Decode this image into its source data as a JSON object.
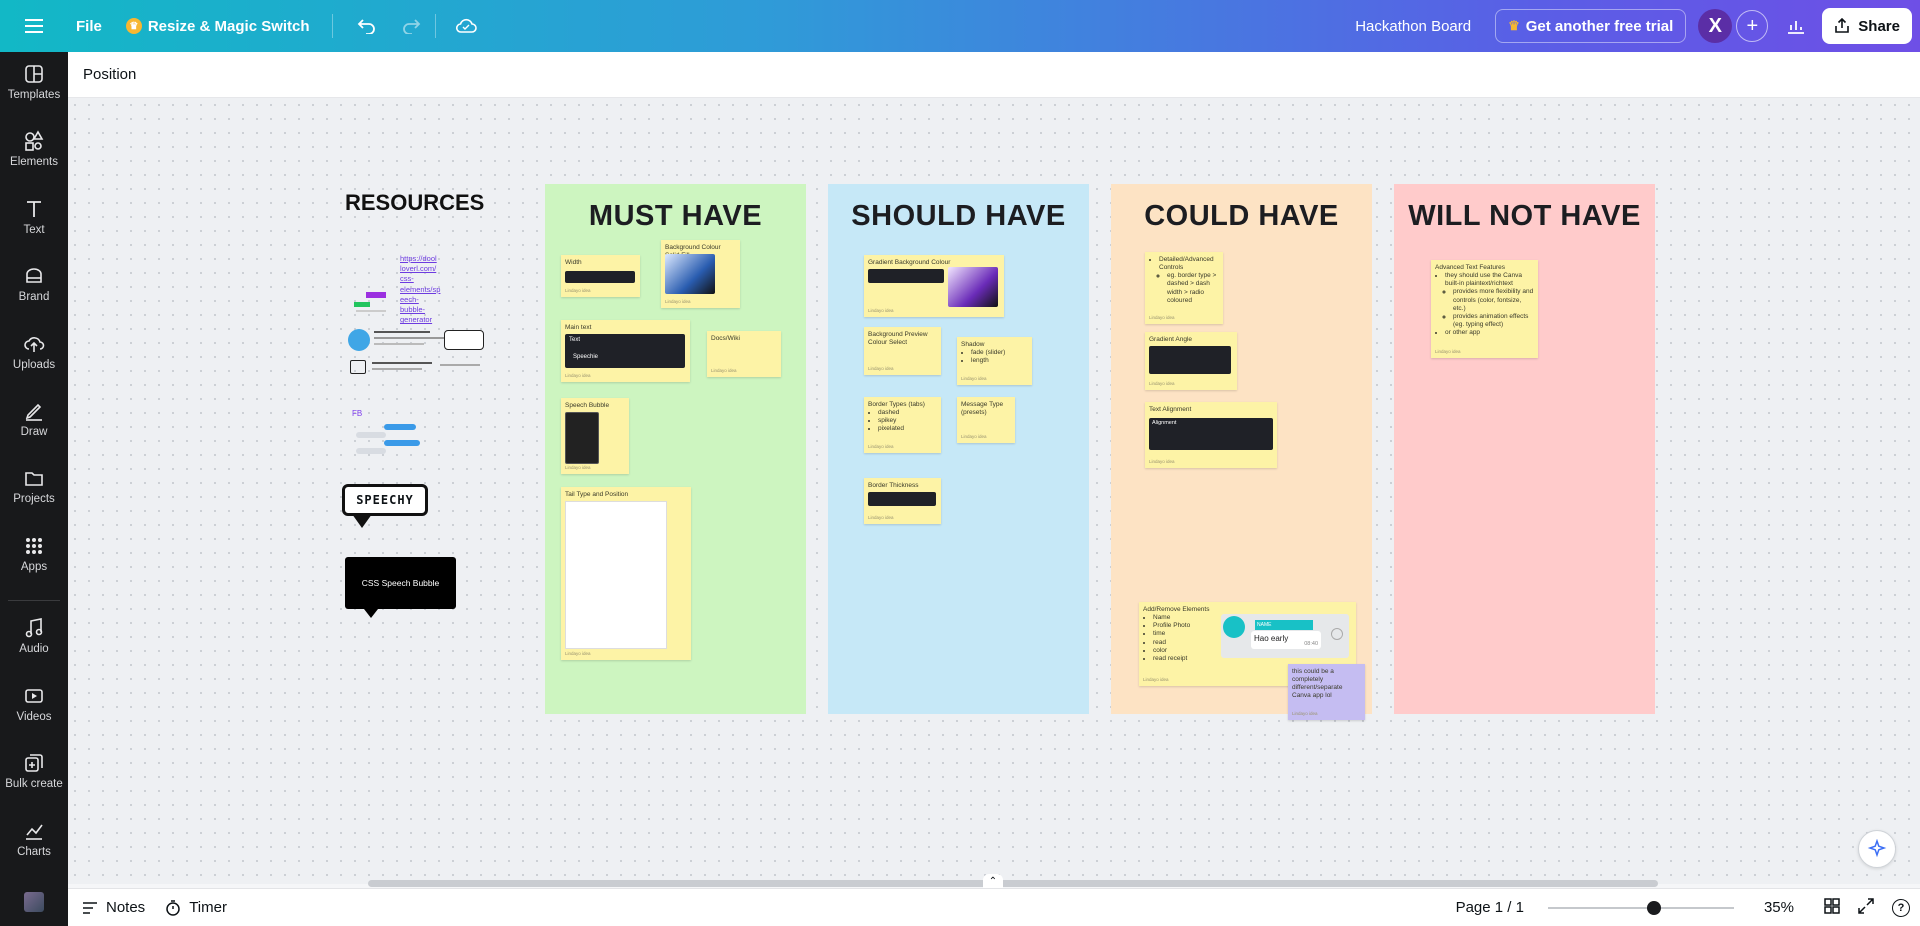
{
  "topbar": {
    "file_label": "File",
    "resize_label": "Resize & Magic Switch",
    "board_title": "Hackathon Board",
    "trial_label": "Get another free trial",
    "avatar_letter": "X",
    "share_label": "Share",
    "crown_icon": "crown-icon"
  },
  "position_label": "Position",
  "sidebar": {
    "items": [
      {
        "label": "Templates",
        "icon": "templates-icon"
      },
      {
        "label": "Elements",
        "icon": "elements-icon"
      },
      {
        "label": "Text",
        "icon": "text-icon"
      },
      {
        "label": "Brand",
        "icon": "brand-icon"
      },
      {
        "label": "Uploads",
        "icon": "uploads-icon"
      },
      {
        "label": "Draw",
        "icon": "draw-icon"
      },
      {
        "label": "Projects",
        "icon": "projects-icon"
      },
      {
        "label": "Apps",
        "icon": "apps-icon"
      },
      {
        "label": "Audio",
        "icon": "audio-icon"
      },
      {
        "label": "Videos",
        "icon": "videos-icon"
      },
      {
        "label": "Bulk create",
        "icon": "bulk-create-icon"
      },
      {
        "label": "Charts",
        "icon": "charts-icon"
      }
    ]
  },
  "bottombar": {
    "notes_label": "Notes",
    "timer_label": "Timer",
    "page_label": "Page 1 / 1",
    "zoom_label": "35%",
    "zoom_fraction": 0.57
  },
  "board": {
    "resources_title": "RESOURCES",
    "resource_link": "https://dool\nloverl.com/\ncss-\nelements/sp\neech-\nbubble-\ngenerator",
    "resource_fb": "FB",
    "speechy_label": "SPEECHY",
    "css_bubble_label": "CSS Speech Bubble",
    "columns": [
      {
        "title": "MUST HAVE",
        "color": "#cdf5c0"
      },
      {
        "title": "SHOULD HAVE",
        "color": "#c6e8f7"
      },
      {
        "title": "COULD HAVE",
        "color": "#fde3c4"
      },
      {
        "title": "WILL NOT HAVE",
        "color": "#ffcbcb"
      }
    ],
    "sticky_footer": "Lindayo idea",
    "must": {
      "width": "Width",
      "bg_solid": "Background Colour Solid Fill",
      "main_text": "Main text",
      "text_label": "Text",
      "speechie": "Speechie",
      "docs_wiki": "Docs/Wiki",
      "speech_bubble": "Speech Bubble",
      "tail_type": "Tail Type and Position"
    },
    "should": {
      "gradient_bg": "Gradient Background Colour",
      "bg_preview": "Background Preview Colour Select",
      "shadow": "Shadow",
      "shadow_items": [
        "fade (slider)",
        "length"
      ],
      "border_types": "Border Types (tabs)",
      "border_items": [
        "dashed",
        "spikey",
        "pixelated"
      ],
      "message_type": "Message Type (presets)",
      "border_thickness": "Border Thickness"
    },
    "could": {
      "detailed_items": [
        "Detailed/Advanced Controls"
      ],
      "detailed_sub": [
        "eg. border type > dashed > dash width > radio coloured"
      ],
      "gradient_angle": "Gradient Angle",
      "text_alignment": "Text Alignment",
      "alignment_label": "Alignment",
      "add_remove": "Add/Remove Elements",
      "add_remove_items": [
        "Name",
        "Profile Photo",
        "time",
        "read",
        "color",
        "read receipt"
      ],
      "name_chip": "NAME",
      "hao_early": "Hao early",
      "time": "08:40",
      "purple_note": "this could be a completely different/separate Canva app lol"
    },
    "willnot": {
      "advanced": "Advanced Text Features",
      "items": [
        "they should use the Canva built-in plaintext/richtext"
      ],
      "sub": [
        "provides more flexibility and controls (color, fontsize, etc.)",
        "provides animation effects (eg. typing effect)"
      ],
      "tail": [
        "or other app"
      ]
    }
  }
}
